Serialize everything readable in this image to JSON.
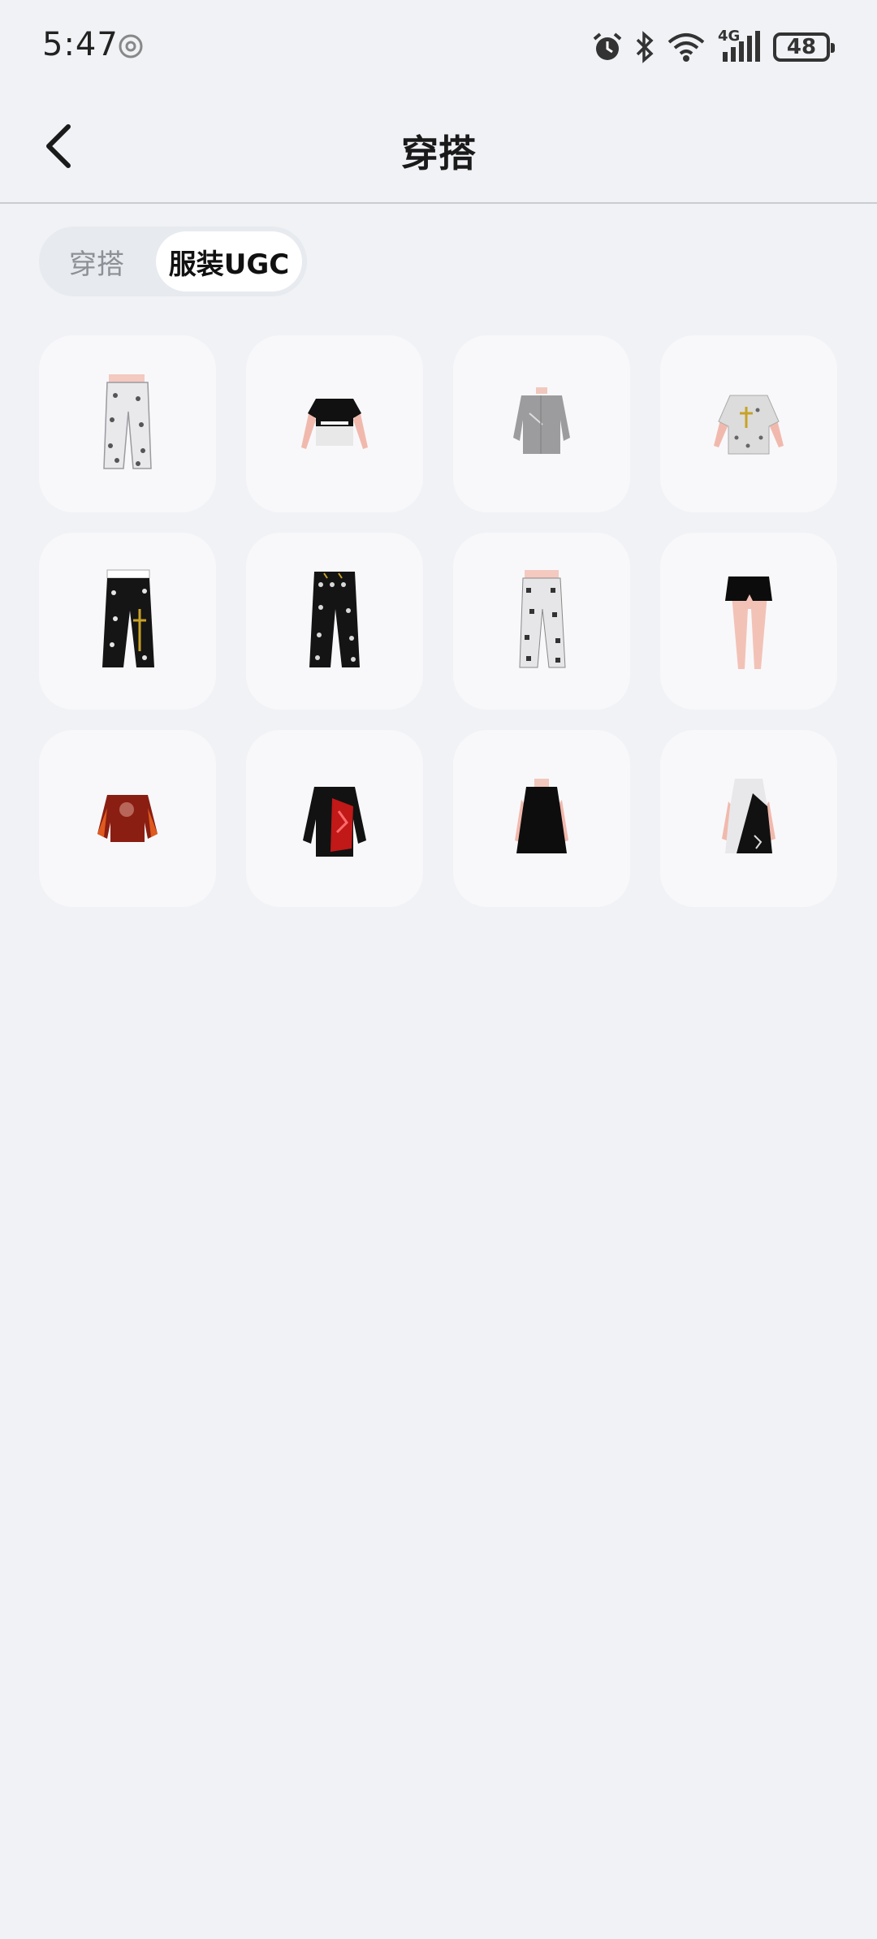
{
  "status_bar": {
    "time": "5:47",
    "network": "4G",
    "battery": "48"
  },
  "header": {
    "title": "穿搭"
  },
  "tabs": [
    {
      "label": "穿搭",
      "active": false
    },
    {
      "label": "服装UGC",
      "active": true
    }
  ],
  "items": [
    {
      "icon": "white-patterned-pants-icon"
    },
    {
      "icon": "black-white-tshirt-icon"
    },
    {
      "icon": "gray-jacket-icon"
    },
    {
      "icon": "white-print-shirt-icon"
    },
    {
      "icon": "black-patterned-pants-icon"
    },
    {
      "icon": "black-print-pants-icon"
    },
    {
      "icon": "white-pattern-pants-icon"
    },
    {
      "icon": "black-shorts-icon"
    },
    {
      "icon": "red-top-icon"
    },
    {
      "icon": "black-red-coat-icon"
    },
    {
      "icon": "black-dress-icon"
    },
    {
      "icon": "black-white-dress-icon"
    }
  ]
}
